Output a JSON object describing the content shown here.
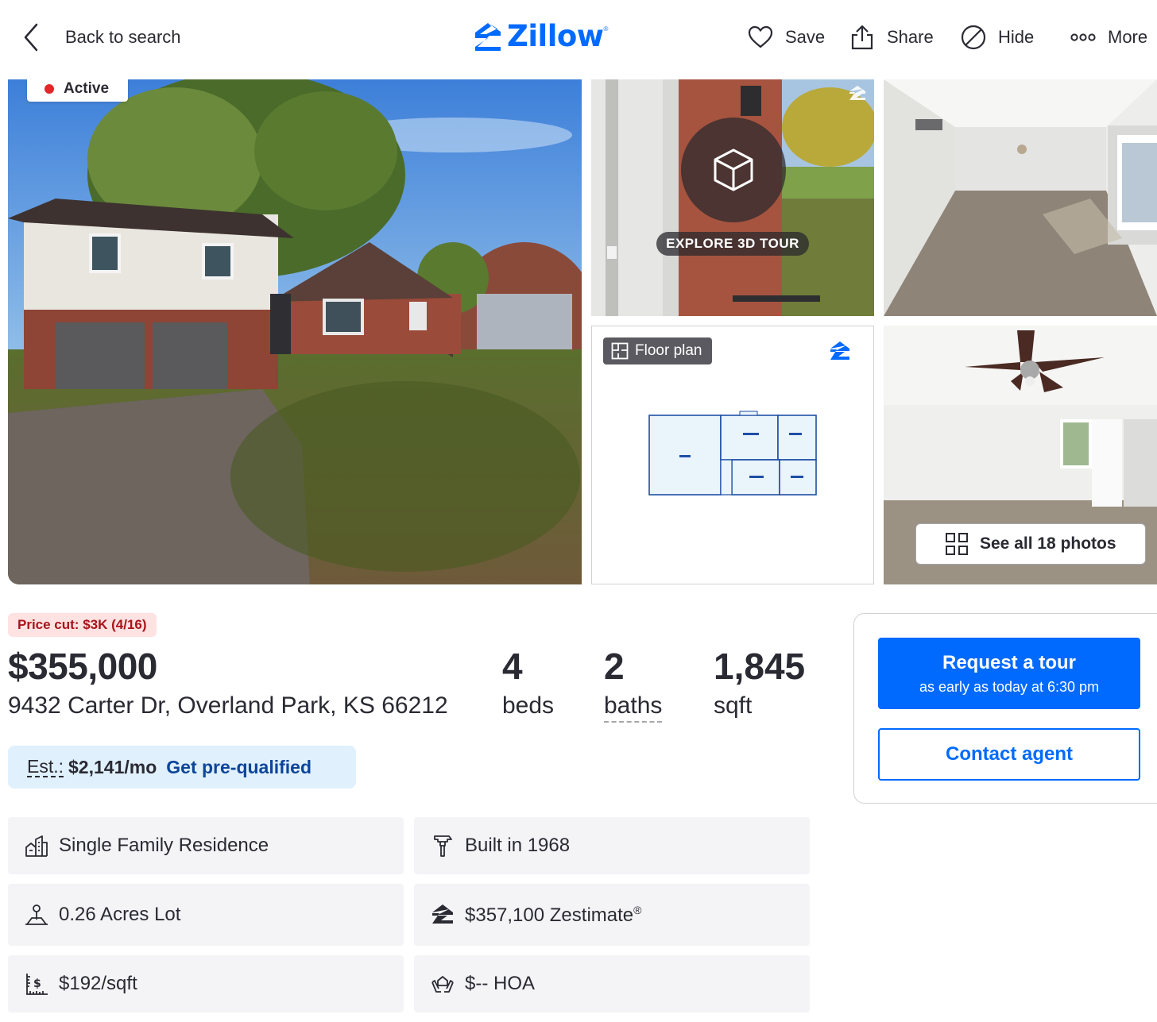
{
  "header": {
    "back_label": "Back to search",
    "logo_text": "Zillow",
    "actions": [
      {
        "label": "Save",
        "icon": "heart-icon"
      },
      {
        "label": "Share",
        "icon": "share-icon"
      },
      {
        "label": "Hide",
        "icon": "hide-icon"
      },
      {
        "label": "More",
        "icon": "more-icon"
      }
    ]
  },
  "gallery": {
    "status_badge": "Active",
    "tour_label": "EXPLORE 3D TOUR",
    "floor_plan_label": "Floor plan",
    "see_all_label": "See all 18 photos"
  },
  "listing": {
    "price_cut": "Price cut: $3K (4/16)",
    "price": "$355,000",
    "address": "9432 Carter Dr, Overland Park, KS 66212",
    "stats": [
      {
        "value": "4",
        "label": "beds"
      },
      {
        "value": "2",
        "label": "baths"
      },
      {
        "value": "1,845",
        "label": "sqft"
      }
    ],
    "estimate_label": "Est.:",
    "estimate_value": "$2,141/mo",
    "prequal_link": "Get pre-qualified"
  },
  "facts": [
    {
      "text": "Single Family Residence",
      "icon": "home-type-icon"
    },
    {
      "text": "Built in 1968",
      "icon": "hammer-icon"
    },
    {
      "text": "0.26 Acres Lot",
      "icon": "lot-icon"
    },
    {
      "text": "$357,100 Zestimate",
      "suffix": "®",
      "icon": "zestimate-icon"
    },
    {
      "text": "$192/sqft",
      "icon": "price-per-sqft-icon"
    },
    {
      "text": "$-- HOA",
      "icon": "hoa-icon"
    }
  ],
  "contact_card": {
    "tour_button": "Request a tour",
    "tour_sub": "as early as today at 6:30 pm",
    "contact_button": "Contact agent"
  },
  "colors": {
    "brand": "#006aff",
    "text": "#2a2a33",
    "price_cut_bg": "#ffe2e2",
    "price_cut_text": "#a7151a",
    "estimate_bg": "#e0f0fd",
    "fact_bg": "#f4f4f7"
  }
}
